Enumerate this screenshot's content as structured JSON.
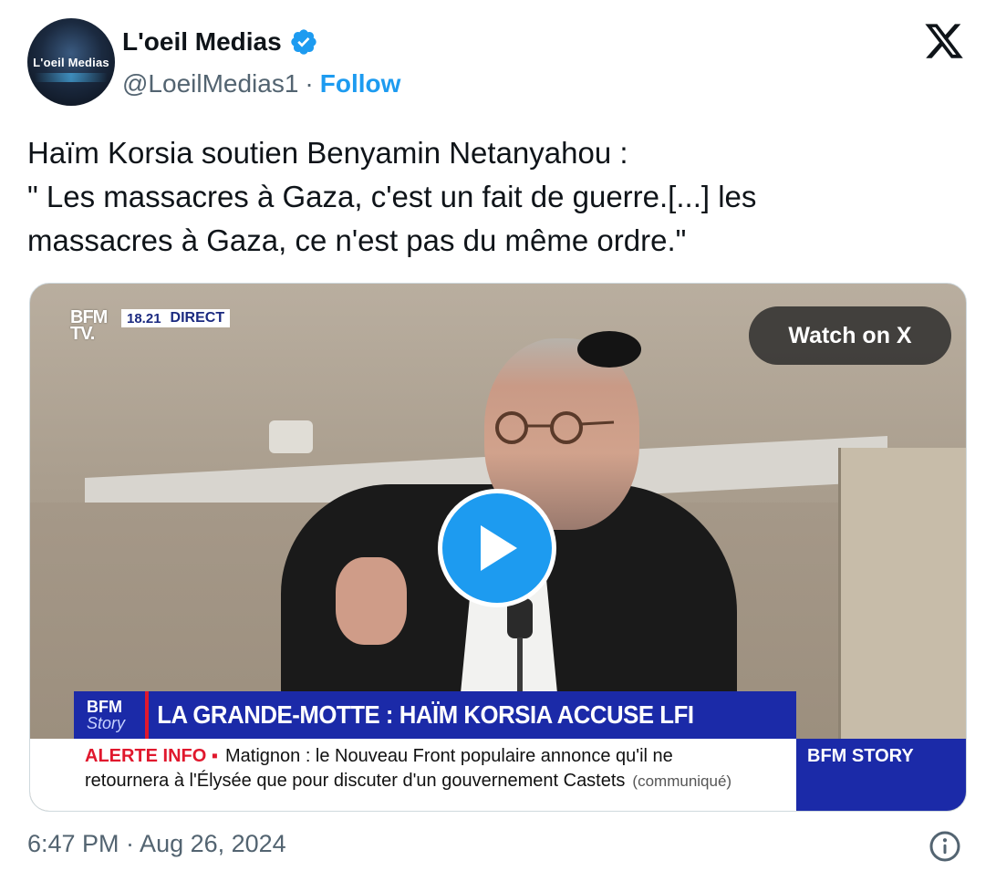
{
  "author": {
    "avatar_text": "L'oeil Medias",
    "display_name": "L'oeil Medias",
    "handle": "@LoeilMedias1",
    "separator": "·",
    "follow_label": "Follow",
    "verified_color": "#1d9bf0"
  },
  "brand": {
    "logo_icon": "x-logo-icon"
  },
  "tweet": {
    "lines": [
      "Haïm Korsia soutien Benyamin Netanyahou  :",
      "\" Les massacres à Gaza, c'est un fait de guerre.[...] les",
      "massacres à Gaza, ce n'est pas du même ordre.\""
    ]
  },
  "media": {
    "watch_label": "Watch on X",
    "play_icon": "play-icon",
    "tv": {
      "channel_logo_line1": "BFM",
      "channel_logo_line2": "TV.",
      "time": "18.21",
      "live_label": "DIRECT",
      "headline_logo_line1": "BFM",
      "headline_logo_line2": "Story",
      "headline": "LA GRANDE-MOTTE : HAÏM KORSIA ACCUSE LFI",
      "alert_label": "ALERTE INFO ▪",
      "ticker_line1": "Matignon : le Nouveau Front populaire annonce qu'il ne",
      "ticker_line2": "retournera à l'Élysée que pour discuter d'un gouvernement Castets",
      "ticker_source": "(communiqué)",
      "story_box": "BFM STORY",
      "brand_blue": "#1b2aa8",
      "alert_red": "#e0182d"
    }
  },
  "footer": {
    "timestamp": "6:47 PM · Aug 26, 2024",
    "info_icon": "info-icon"
  }
}
